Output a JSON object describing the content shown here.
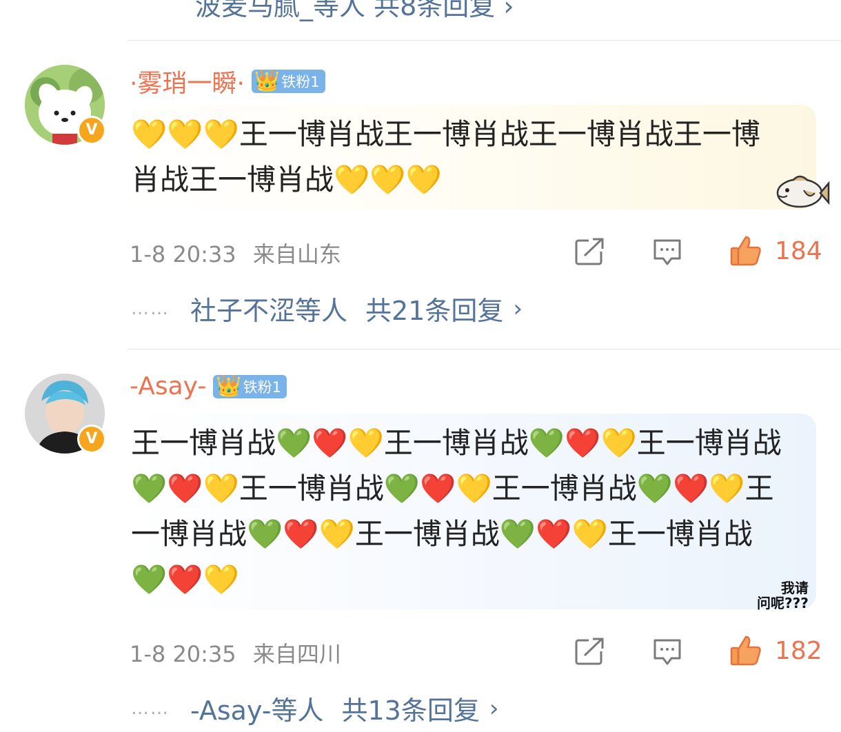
{
  "top_reply_partial": "波麦马腻_等人  共8条回复 ›",
  "comments": [
    {
      "username": "·雾琑一瞬·",
      "fan_badge": "铁粉1",
      "text": "💛💛💛王一博肖战王一博肖战王一博肖战王一博肖战王一博肖战💛💛💛",
      "time": "1-8 20:33",
      "location": "来自山东",
      "likes": "184",
      "reply_users": "社子不涩等人",
      "reply_count": "共21条回复"
    },
    {
      "username": "-Asay-",
      "fan_badge": "铁粉1",
      "text": "王一博肖战💚❤️💛王一博肖战💚❤️💛王一博肖战💚❤️💛王一博肖战💚❤️💛王一博肖战💚❤️💛王一博肖战💚❤️💛王一博肖战💚❤️💛王一博肖战💚❤️💛",
      "time": "1-8 20:35",
      "location": "来自四川",
      "likes": "182",
      "reply_users": "-Asay-等人",
      "reply_count": "共13条回复",
      "sticker_line1": "我请",
      "sticker_line2": "问呢???"
    }
  ],
  "icons": {
    "verified": "v-badge-icon",
    "share": "share-icon",
    "comment": "comment-icon",
    "like": "thumbs-up-icon",
    "chevron": "chevron-right-icon"
  },
  "colors": {
    "username": "#eb7350",
    "link": "#53739b",
    "meta": "#8a8a8a",
    "fan_badge": "#7ab2ea"
  }
}
